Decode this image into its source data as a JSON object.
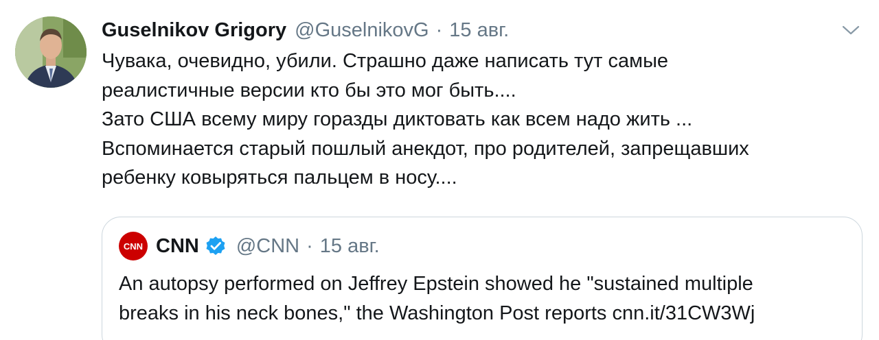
{
  "tweet": {
    "author_name": "Guselnikov Grigory",
    "author_handle": "@GuselnikovG",
    "separator": "·",
    "date": "15 авг.",
    "text_lines": [
      "Чувака, очевидно, убили. Страшно даже написать тут самые",
      "реалистичные версии кто бы это мог быть....",
      "Зато США всему миру горазды диктовать как всем надо жить ...",
      "Вспоминается старый пошлый анекдот, про родителей, запрещавших",
      "ребенку ковыряться пальцем в носу...."
    ]
  },
  "quoted_tweet": {
    "logo_text": "CNN",
    "author_name": "CNN",
    "verified": true,
    "author_handle": "@CNN",
    "separator": "·",
    "date": "15 авг.",
    "text_lines": [
      "An autopsy performed on Jeffrey Epstein showed he \"sustained multiple",
      "breaks in his neck bones,\" the Washington Post reports cnn.it/31CW3Wj"
    ]
  },
  "icons": {
    "menu": "chevron-down-icon",
    "verified": "verified-badge-icon"
  },
  "colors": {
    "text_primary": "#14171a",
    "text_secondary": "#657786",
    "border": "#ccd6dd",
    "verified_blue": "#1da1f2",
    "cnn_red": "#cc0000"
  }
}
